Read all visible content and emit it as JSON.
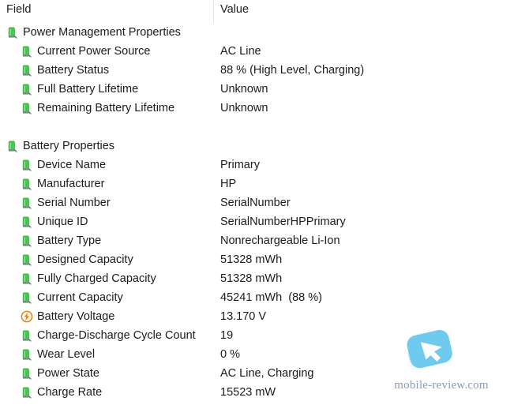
{
  "header": {
    "field_label": "Field",
    "value_label": "Value"
  },
  "rows": [
    {
      "type": "row",
      "level": 0,
      "icon": "battery-icon",
      "label": "Power Management Properties",
      "value": ""
    },
    {
      "type": "row",
      "level": 1,
      "icon": "battery-icon",
      "label": "Current Power Source",
      "value": "AC Line"
    },
    {
      "type": "row",
      "level": 1,
      "icon": "battery-icon",
      "label": "Battery Status",
      "value": "88 % (High Level, Charging)"
    },
    {
      "type": "row",
      "level": 1,
      "icon": "battery-icon",
      "label": "Full Battery Lifetime",
      "value": "Unknown"
    },
    {
      "type": "row",
      "level": 1,
      "icon": "battery-icon",
      "label": "Remaining Battery Lifetime",
      "value": "Unknown"
    },
    {
      "type": "spacer"
    },
    {
      "type": "row",
      "level": 0,
      "icon": "battery-icon",
      "label": "Battery Properties",
      "value": ""
    },
    {
      "type": "row",
      "level": 1,
      "icon": "battery-icon",
      "label": "Device Name",
      "value": "Primary"
    },
    {
      "type": "row",
      "level": 1,
      "icon": "battery-icon",
      "label": "Manufacturer",
      "value": "HP"
    },
    {
      "type": "row",
      "level": 1,
      "icon": "battery-icon",
      "label": "Serial Number",
      "value": "SerialNumber"
    },
    {
      "type": "row",
      "level": 1,
      "icon": "battery-icon",
      "label": "Unique ID",
      "value": "SerialNumberHPPrimary"
    },
    {
      "type": "row",
      "level": 1,
      "icon": "battery-icon",
      "label": "Battery Type",
      "value": "Nonrechargeable Li-Ion"
    },
    {
      "type": "row",
      "level": 1,
      "icon": "battery-icon",
      "label": "Designed Capacity",
      "value": "51328 mWh"
    },
    {
      "type": "row",
      "level": 1,
      "icon": "battery-icon",
      "label": "Fully Charged Capacity",
      "value": "51328 mWh"
    },
    {
      "type": "row",
      "level": 1,
      "icon": "battery-icon",
      "label": "Current Capacity",
      "value": "45241 mWh  (88 %)"
    },
    {
      "type": "row",
      "level": 1,
      "icon": "voltage-bolt-icon",
      "label": "Battery Voltage",
      "value": "13.170 V"
    },
    {
      "type": "row",
      "level": 1,
      "icon": "battery-icon",
      "label": "Charge-Discharge Cycle Count",
      "value": "19"
    },
    {
      "type": "row",
      "level": 1,
      "icon": "battery-icon",
      "label": "Wear Level",
      "value": "0 %"
    },
    {
      "type": "row",
      "level": 1,
      "icon": "battery-icon",
      "label": "Power State",
      "value": "AC Line, Charging"
    },
    {
      "type": "row",
      "level": 1,
      "icon": "battery-icon",
      "label": "Charge Rate",
      "value": "15523 mW"
    }
  ],
  "watermark": {
    "text": "mobile-review.com",
    "logo_icon": "cursor-arrow-logo",
    "logo_color": "#6ecbef"
  },
  "colors": {
    "background": "#ffffff",
    "text": "#1b1b1b",
    "divider": "#e2e2e2",
    "battery_green": "#3bb34a",
    "voltage_orange": "#e8820c",
    "watermark_text": "#8b9bbb"
  }
}
